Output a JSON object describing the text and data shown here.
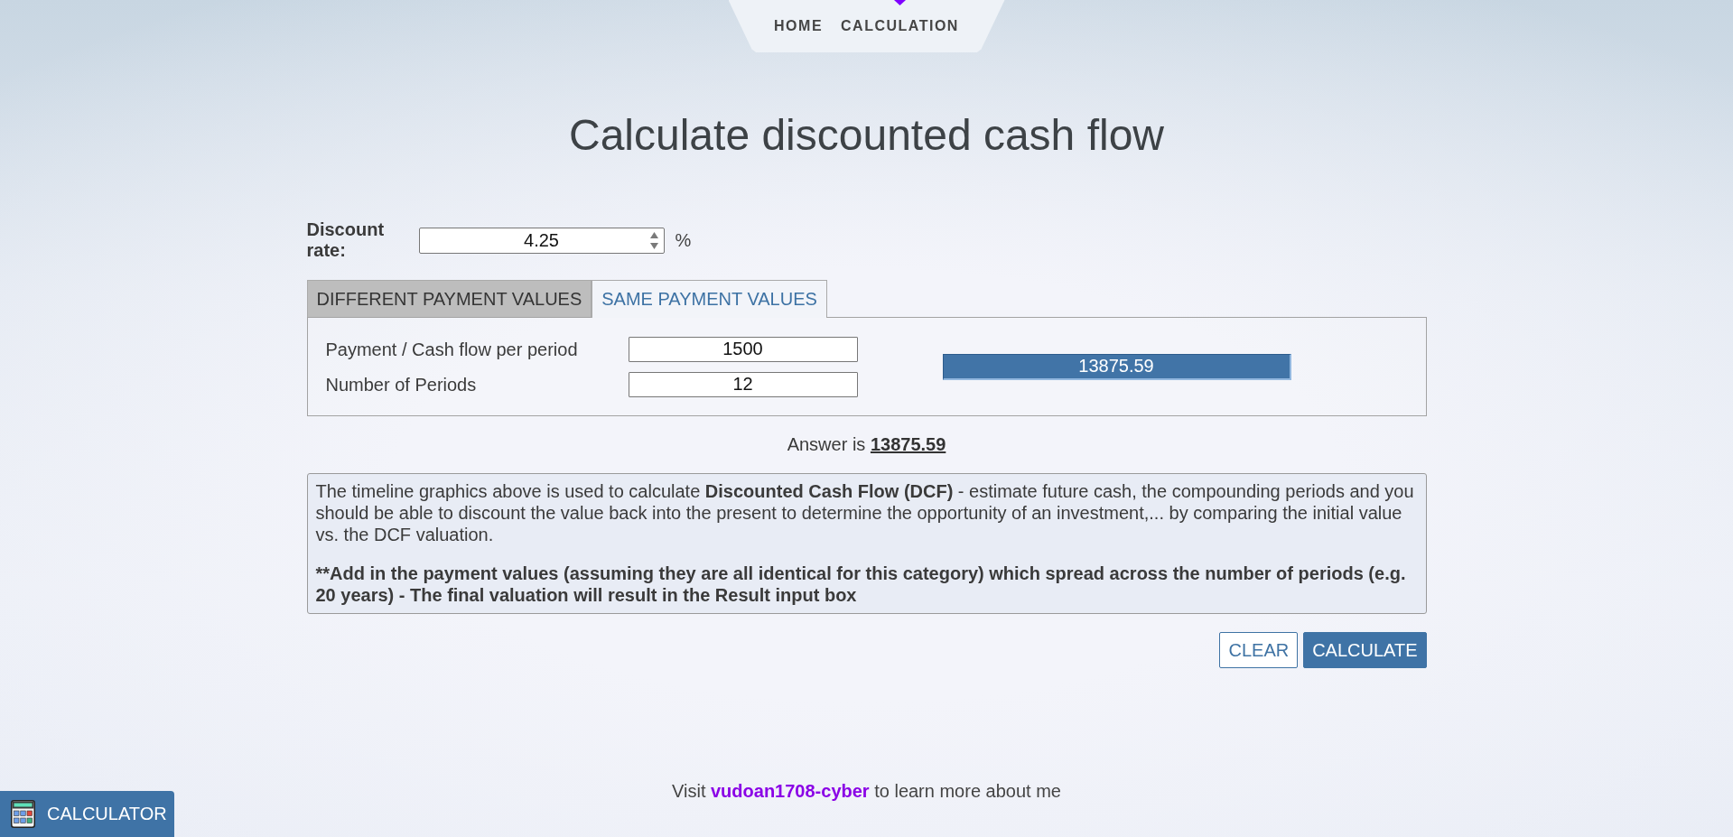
{
  "nav": {
    "items": [
      {
        "label": "HOME",
        "selected": false
      },
      {
        "label": "CALCULATION",
        "selected": true
      }
    ]
  },
  "title": "Calculate discounted cash flow",
  "discount_rate": {
    "label": "Discount rate:",
    "value": "4.25",
    "unit": "%"
  },
  "tabs": [
    {
      "label": "DIFFERENT PAYMENT VALUES",
      "selected": false
    },
    {
      "label": "SAME PAYMENT VALUES",
      "selected": true
    }
  ],
  "form": {
    "fields": [
      {
        "label": "Payment / Cash flow per period",
        "value": "1500"
      },
      {
        "label": "Number of Periods",
        "value": "12"
      }
    ],
    "result": "13875.59"
  },
  "answer": "Answer is **13875.59**",
  "description": {
    "paragraphs": [
      {
        "text": "The timeline graphics above is used to calculate **Discounted Cash Flow (DCF)** - estimate future cash, the compounding periods and you should be able to discount the value back into the present to determine the opportunity of an investment,... by comparing the initial value vs. the DCF valuation.",
        "bold": false
      },
      {
        "text": "**Add in the payment values (assuming they are all identical for this category) which spread across the number of periods (e.g. 20 years) - The final valuation will result in the Result input box",
        "bold": true
      }
    ]
  },
  "buttons": [
    {
      "label": "CLEAR",
      "kind": "outline"
    },
    {
      "label": "CALCULATE",
      "kind": "primary"
    }
  ],
  "footer": {
    "before": "Visit",
    "link": "vudoan1708-cyber",
    "after": "to learn more about me"
  },
  "calculator_button": {
    "label": "CALCULATOR"
  }
}
